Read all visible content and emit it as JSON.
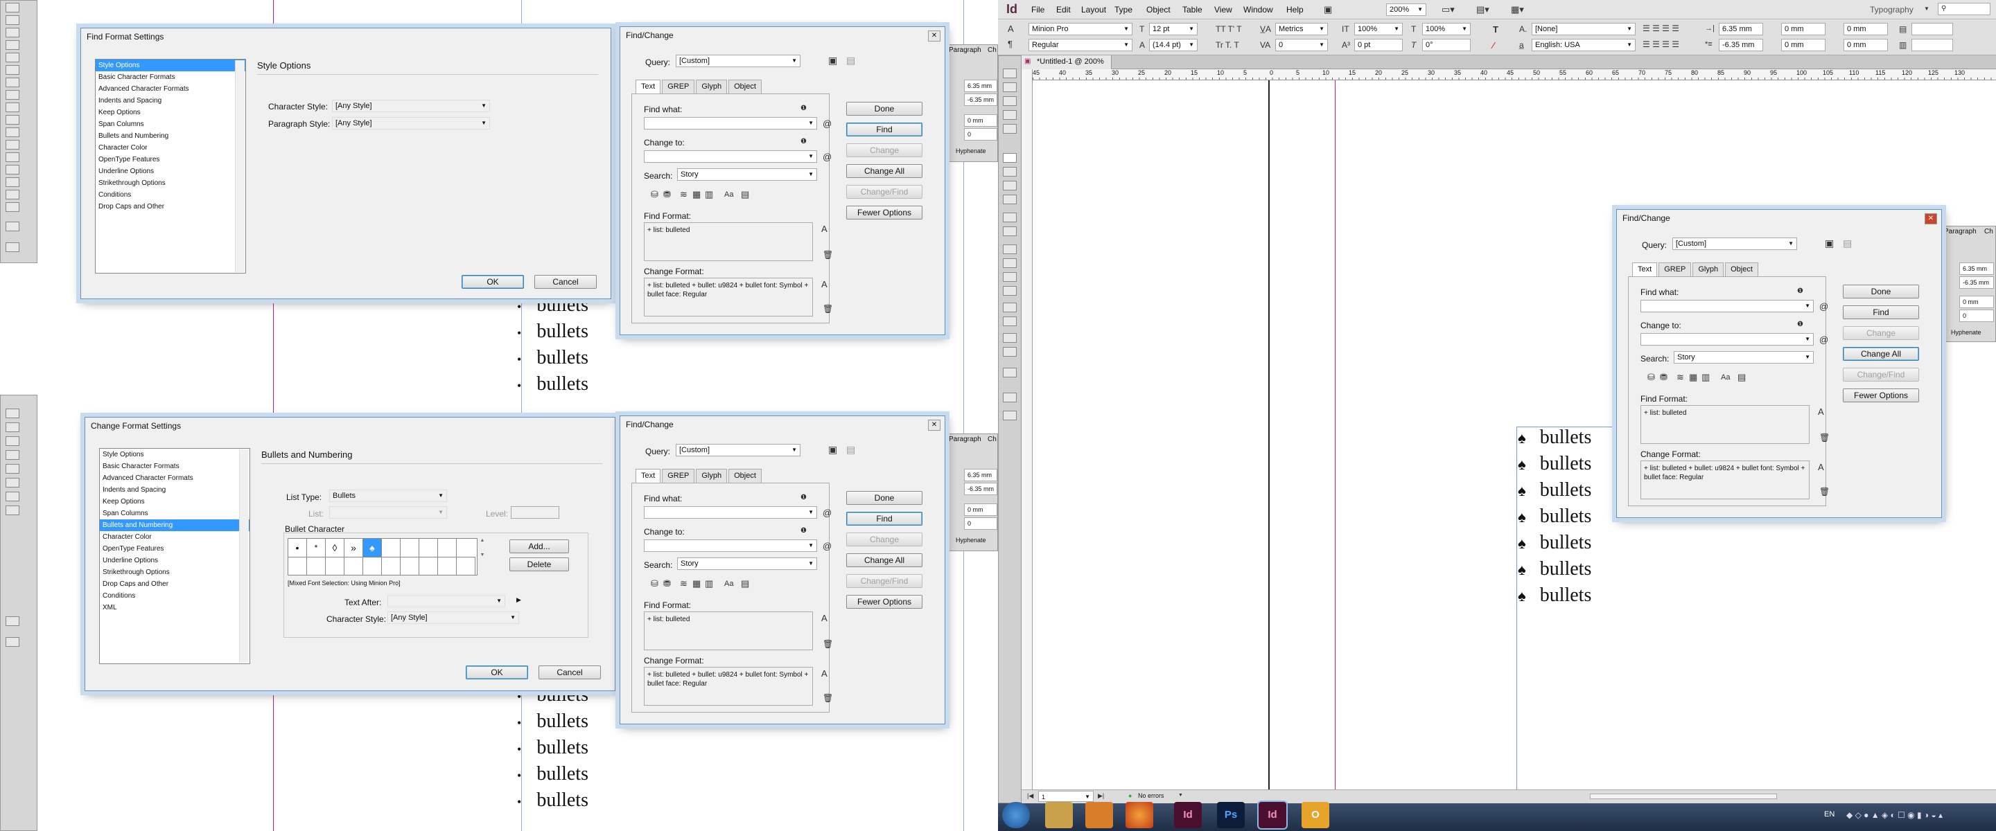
{
  "left_app": {
    "document_bullets_top": [
      "bullets",
      "bullets",
      "bullets",
      "bullets"
    ],
    "document_bullets_bottom": [
      "bullets",
      "bullets",
      "bullets",
      "bullets",
      "bullets"
    ],
    "panel_tab_paragraph": "Paragraph",
    "panel_tab_char": "Ch",
    "mm_values": [
      "6.35 mm",
      "-6.35 mm",
      "0 mm",
      "0"
    ],
    "hyphenate": "Hyphenate"
  },
  "find_format_dialog": {
    "title": "Find Format Settings",
    "categories": [
      "Style Options",
      "Basic Character Formats",
      "Advanced Character Formats",
      "Indents and Spacing",
      "Keep Options",
      "Span Columns",
      "Bullets and Numbering",
      "Character Color",
      "OpenType Features",
      "Underline Options",
      "Strikethrough Options",
      "Conditions",
      "Drop Caps and Other"
    ],
    "section_title": "Style Options",
    "char_style_label": "Character Style:",
    "char_style_value": "[Any Style]",
    "para_style_label": "Paragraph Style:",
    "para_style_value": "[Any Style]",
    "ok": "OK",
    "cancel": "Cancel"
  },
  "change_format_dialog": {
    "title": "Change Format Settings",
    "categories": [
      "Style Options",
      "Basic Character Formats",
      "Advanced Character Formats",
      "Indents and Spacing",
      "Keep Options",
      "Span Columns",
      "Bullets and Numbering",
      "Character Color",
      "OpenType Features",
      "Underline Options",
      "Strikethrough Options",
      "Drop Caps and Other",
      "Conditions",
      "XML"
    ],
    "section_title": "Bullets and Numbering",
    "list_type_label": "List Type:",
    "list_type_value": "Bullets",
    "list_label": "List:",
    "level_label": "Level:",
    "bullet_char_label": "Bullet Character",
    "bullet_glyphs": [
      "•",
      "*",
      "◊",
      "»",
      "♠"
    ],
    "add": "Add...",
    "delete": "Delete",
    "mixed_font": "[Mixed Font Selection: Using Minion Pro]",
    "text_after_label": "Text After:",
    "char_style_label": "Character Style:",
    "char_style_value": "[Any Style]",
    "ok": "OK",
    "cancel": "Cancel"
  },
  "find_change": {
    "title": "Find/Change",
    "query_label": "Query:",
    "query_value": "[Custom]",
    "tabs": [
      "Text",
      "GREP",
      "Glyph",
      "Object"
    ],
    "find_what": "Find what:",
    "change_to": "Change to:",
    "search_label": "Search:",
    "search_value": "Story",
    "aa": "Aa",
    "find_format_label": "Find Format:",
    "find_format_value": "+ list: bulleted",
    "change_format_label": "Change Format:",
    "change_format_value": "+ list: bulleted + bullet: u9824 + bullet font: Symbol + bullet face: Regular",
    "buttons": [
      "Done",
      "Find",
      "Change",
      "Change All",
      "Change/Find",
      "Fewer Options"
    ]
  },
  "indesign": {
    "logo": "Id",
    "menu": [
      "File",
      "Edit",
      "Layout",
      "Type",
      "Object",
      "Table",
      "View",
      "Window",
      "Help"
    ],
    "zoom": "200%",
    "workspace": "Typography",
    "font": "Minion Pro",
    "style": "Regular",
    "size": "12 pt",
    "leading": "(14.4 pt)",
    "kerning": "Metrics",
    "tracking": "0",
    "scale_v": "100%",
    "scale_h": "100%",
    "baseline": "0 pt",
    "skew": "0°",
    "char_style": "[None]",
    "language": "English: USA",
    "indent_vals": [
      "6.35 mm",
      "-6.35 mm",
      "0 mm",
      "0 mm",
      "0 mm",
      "0 mm"
    ],
    "doc_tab": "*Untitled-1 @ 200%",
    "ruler_nums": [
      "45",
      "40",
      "35",
      "30",
      "25",
      "20",
      "15",
      "10",
      "5",
      "0",
      "5",
      "10",
      "15",
      "20",
      "25",
      "30",
      "35",
      "40",
      "45",
      "50",
      "55",
      "60",
      "65",
      "70",
      "75",
      "80",
      "85",
      "90",
      "95",
      "100",
      "105",
      "110",
      "115",
      "120",
      "125",
      "130"
    ],
    "bullet_symbol": "♠",
    "bullets": [
      "bullets",
      "bullets",
      "bullets",
      "bullets",
      "bullets",
      "bullets",
      "bullets"
    ],
    "page_num": "1",
    "status": "No errors",
    "panel_paragraph": "Paragraph",
    "panel_ch": "Ch",
    "panel_vals": [
      "6.35 mm",
      "-6.35 mm",
      "0 mm",
      "0"
    ],
    "hyphenate": "Hyphenate"
  },
  "taskbar": {
    "lang": "EN",
    "apps": [
      "start",
      "explorer",
      "media",
      "firefox",
      "indesign-1",
      "photoshop",
      "indesign-2",
      "outlook"
    ],
    "app_labels": {
      "indesign-1": "Id",
      "photoshop": "Ps",
      "indesign-2": "Id",
      "outlook": "O"
    }
  }
}
